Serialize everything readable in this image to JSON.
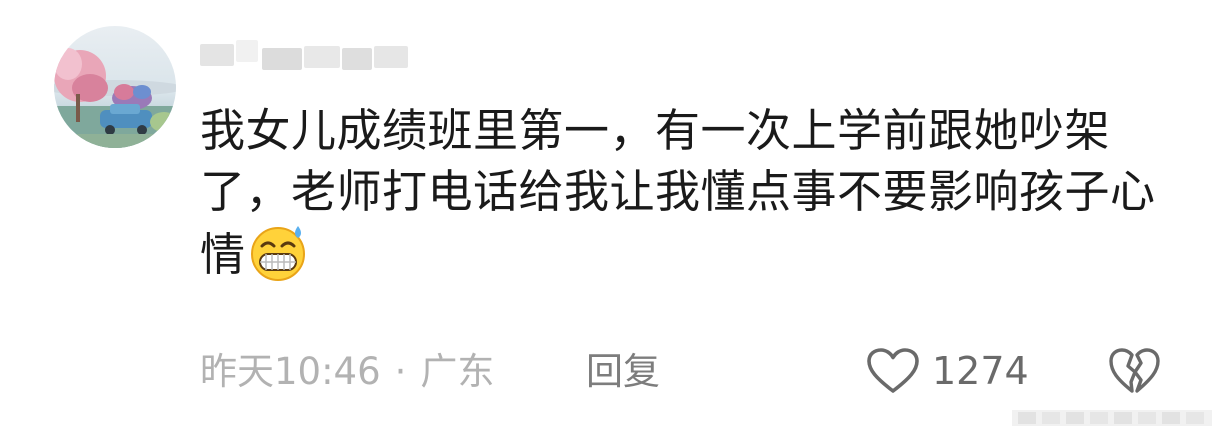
{
  "comment": {
    "text": "我女儿成绩班里第一，有一次上学前跟她吵架了，老师打电话给我让我懂点事不要影响孩子心情",
    "emoji": "grinning-sweat-emoji",
    "timestamp": "昨天10:46",
    "separator": "·",
    "location": "广东",
    "reply_label": "回复",
    "like_count": "1274"
  },
  "icons": {
    "like": "heart-outline-icon",
    "dislike": "broken-heart-icon"
  },
  "colors": {
    "text": "#1a1a1a",
    "meta": "#b2b2b2",
    "reply": "#7d7d7d",
    "icon": "#6a6a6a"
  }
}
